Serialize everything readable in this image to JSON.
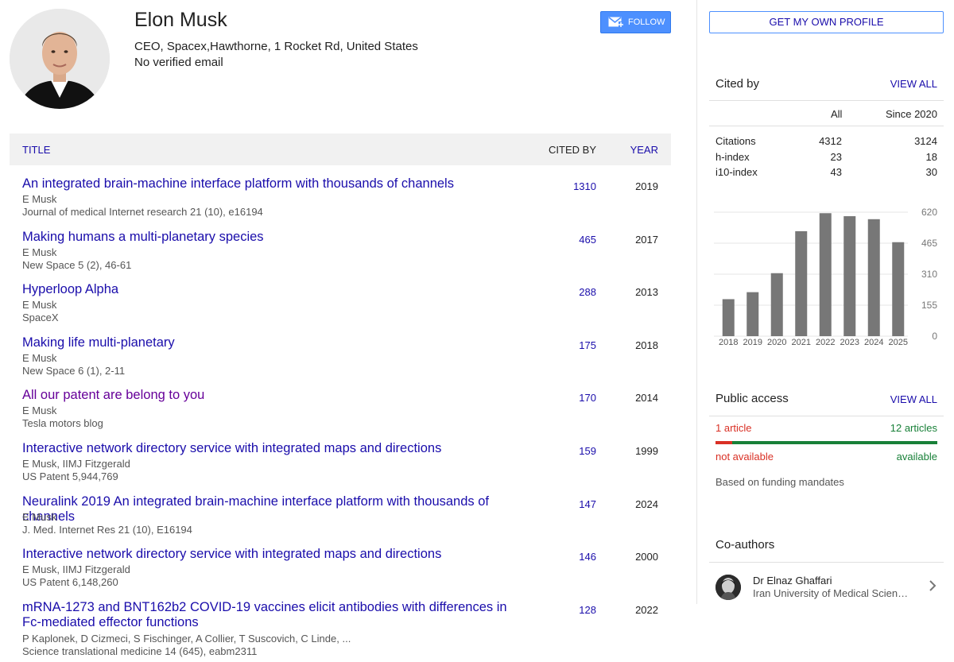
{
  "profile": {
    "name": "Elon Musk",
    "affiliation": "CEO, Spacex,Hawthorne, 1 Rocket Rd, United States",
    "email": "No verified email",
    "follow_label": "FOLLOW",
    "avatar_icon": "profile-photo",
    "follow_icon": "mail-plus-icon"
  },
  "table": {
    "headers": {
      "title": "TITLE",
      "cited_by": "CITED BY",
      "year": "YEAR"
    },
    "rows": [
      {
        "title": "An integrated brain-machine interface platform with thousands of channels",
        "authors": "E Musk",
        "venue": "Journal of medical Internet research 21 (10), e16194",
        "cited_by": "1310",
        "year": "2019"
      },
      {
        "title": "Making humans a multi-planetary species",
        "authors": "E Musk",
        "venue": "New Space 5 (2), 46-61",
        "cited_by": "465",
        "year": "2017"
      },
      {
        "title": "Hyperloop Alpha",
        "authors": "E Musk",
        "venue": "SpaceX",
        "cited_by": "288",
        "year": "2013"
      },
      {
        "title": "Making life multi-planetary",
        "authors": "E Musk",
        "venue": "New Space 6 (1), 2-11",
        "cited_by": "175",
        "year": "2018"
      },
      {
        "title": "All our patent are belong to you",
        "authors": "E Musk",
        "venue": "Tesla motors blog",
        "cited_by": "170",
        "year": "2014"
      },
      {
        "title": "Interactive network directory service with integrated maps and directions",
        "authors": "E Musk, IIMJ Fitzgerald",
        "venue": "US Patent 5,944,769",
        "cited_by": "159",
        "year": "1999"
      },
      {
        "title": "Neuralink 2019 An integrated brain-machine interface platform with thousands of channels",
        "authors": "E Musk",
        "venue": "J. Med. Internet Res 21 (10), E16194",
        "cited_by": "147",
        "year": "2024"
      },
      {
        "title": "Interactive network directory service with integrated maps and directions",
        "authors": "E Musk, IIMJ Fitzgerald",
        "venue": "US Patent 6,148,260",
        "cited_by": "146",
        "year": "2000"
      },
      {
        "title": "mRNA-1273 and BNT162b2 COVID-19 vaccines elicit antibodies with differences in Fc-mediated effector functions",
        "authors": "P Kaplonek, D Cizmeci, S Fischinger, A Collier, T Suscovich, C Linde, ...",
        "venue": "Science translational medicine 14 (645), eabm2311",
        "cited_by": "128",
        "year": "2022"
      }
    ]
  },
  "sidebar": {
    "get_profile_label": "GET MY OWN PROFILE",
    "cited_by": {
      "title": "Cited by",
      "view_all": "VIEW ALL",
      "col_all": "All",
      "col_since": "Since 2020",
      "rows": [
        {
          "label": "Citations",
          "all": "4312",
          "since": "3124"
        },
        {
          "label": "h-index",
          "all": "23",
          "since": "18"
        },
        {
          "label": "i10-index",
          "all": "43",
          "since": "30"
        }
      ]
    },
    "public_access": {
      "title": "Public access",
      "view_all": "VIEW ALL",
      "not_available_count": "1 article",
      "available_count": "12 articles",
      "not_available_label": "not available",
      "available_label": "available",
      "note": "Based on funding mandates",
      "not_available_fraction": 0.077,
      "colors": {
        "not_available": "#d93025",
        "available": "#188038"
      }
    },
    "coauthors": {
      "title": "Co-authors",
      "items": [
        {
          "name": "Dr Elnaz Ghaffari",
          "institution": "Iran University of Medical Sciences",
          "icon": "chevron-right-icon"
        }
      ]
    }
  },
  "chart_data": {
    "type": "bar",
    "categories": [
      "2018",
      "2019",
      "2020",
      "2021",
      "2022",
      "2023",
      "2024",
      "2025"
    ],
    "values": [
      185,
      220,
      315,
      525,
      615,
      600,
      585,
      470
    ],
    "yticks": [
      "620",
      "465",
      "310",
      "155",
      "0"
    ],
    "ylim": [
      0,
      620
    ],
    "bar_color": "#777777",
    "grid": true
  },
  "colors": {
    "link": "#1a0dab",
    "visited": "#660099",
    "follow_button": "#4d90fe"
  }
}
